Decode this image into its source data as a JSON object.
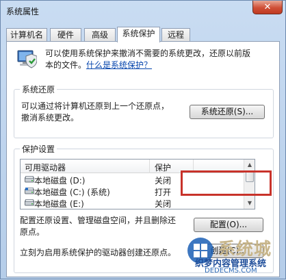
{
  "window": {
    "title": "系统属性",
    "close_glyph": "✕"
  },
  "tabs": [
    {
      "label": "计算机名",
      "active": false
    },
    {
      "label": "硬件",
      "active": false
    },
    {
      "label": "高级",
      "active": false
    },
    {
      "label": "系统保护",
      "active": true
    },
    {
      "label": "远程",
      "active": false
    }
  ],
  "intro": {
    "line1": "可以使用系统保护来撤消不需要的系统更改，还原以前版",
    "line2_prefix": "本的文件。",
    "link": "什么是系统保护？"
  },
  "restore": {
    "group_label": "系统还原",
    "desc_line1": "可以通过将计算机还原到上一个还原点，",
    "desc_line2": "撤消系统更改。",
    "button": "系统还原(S)..."
  },
  "protection": {
    "group_label": "保护设置",
    "columns": [
      "可用驱动器",
      "保护"
    ],
    "drives": [
      {
        "name": "本地磁盘 (D:)",
        "status": "关闭"
      },
      {
        "name": "本地磁盘 (C:) (系统)",
        "status": "打开"
      },
      {
        "name": "本地磁盘 (E:)",
        "status": "关闭"
      }
    ],
    "configure_desc_line1": "配置还原设置、管理磁盘空间，并且删除还",
    "configure_desc_line2": "原点。",
    "configure_button": "配置(O)...",
    "create_desc": "立刻为启用系统保护的驱动器创建还原点。",
    "create_button": "创建(C)..."
  },
  "watermark": {
    "big": "系统城",
    "small": "织梦内容管理系统",
    "url": "DEDECMS.COM"
  },
  "colors": {
    "highlight": "#c8322a",
    "link": "#0645ad",
    "close": "#cf4f36"
  }
}
